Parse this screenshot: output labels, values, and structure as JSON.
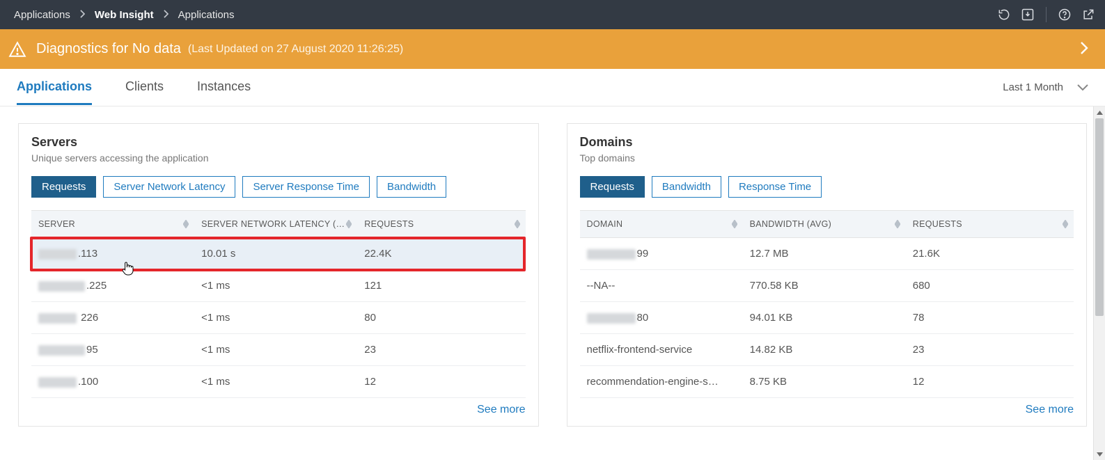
{
  "breadcrumb": {
    "a": "Applications",
    "b": "Web Insight",
    "c": "Applications"
  },
  "banner": {
    "title": "Diagnostics for No data",
    "sub": "(Last Updated on 27 August 2020 11:26:25)"
  },
  "tabs": {
    "applications": "Applications",
    "clients": "Clients",
    "instances": "Instances"
  },
  "range": {
    "label": "Last 1 Month"
  },
  "servers": {
    "heading": "Servers",
    "subtitle": "Unique servers accessing the application",
    "buttons": {
      "requests": "Requests",
      "latency": "Server Network Latency",
      "response": "Server Response Time",
      "bandwidth": "Bandwidth"
    },
    "cols": {
      "server": "SERVER",
      "latency": "SERVER NETWORK LATENCY (…",
      "requests": "REQUESTS"
    },
    "rows": [
      {
        "server_suffix": ".113",
        "latency": "10.01 s",
        "requests": "22.4K",
        "highlight": true
      },
      {
        "server_suffix": ".225",
        "latency": "<1 ms",
        "requests": "121"
      },
      {
        "server_suffix": " 226",
        "latency": "<1 ms",
        "requests": "80"
      },
      {
        "server_suffix": "95",
        "latency": "<1 ms",
        "requests": "23"
      },
      {
        "server_suffix": ".100",
        "latency": "<1 ms",
        "requests": "12"
      }
    ],
    "see_more": "See more"
  },
  "domains": {
    "heading": "Domains",
    "subtitle": "Top domains",
    "buttons": {
      "requests": "Requests",
      "bandwidth": "Bandwidth",
      "response": "Response Time"
    },
    "cols": {
      "domain": "DOMAIN",
      "bandwidth": "BANDWIDTH (AVG)",
      "requests": "REQUESTS"
    },
    "rows": [
      {
        "domain_suffix": "99",
        "bandwidth": "12.7 MB",
        "requests": "21.6K",
        "blurred": true
      },
      {
        "domain": "--NA--",
        "bandwidth": "770.58 KB",
        "requests": "680"
      },
      {
        "domain_suffix": "80",
        "bandwidth": "94.01 KB",
        "requests": "78",
        "blurred": true
      },
      {
        "domain": "netflix-frontend-service",
        "bandwidth": "14.82 KB",
        "requests": "23"
      },
      {
        "domain": "recommendation-engine-s…",
        "bandwidth": "8.75 KB",
        "requests": "12"
      }
    ],
    "see_more": "See more"
  }
}
